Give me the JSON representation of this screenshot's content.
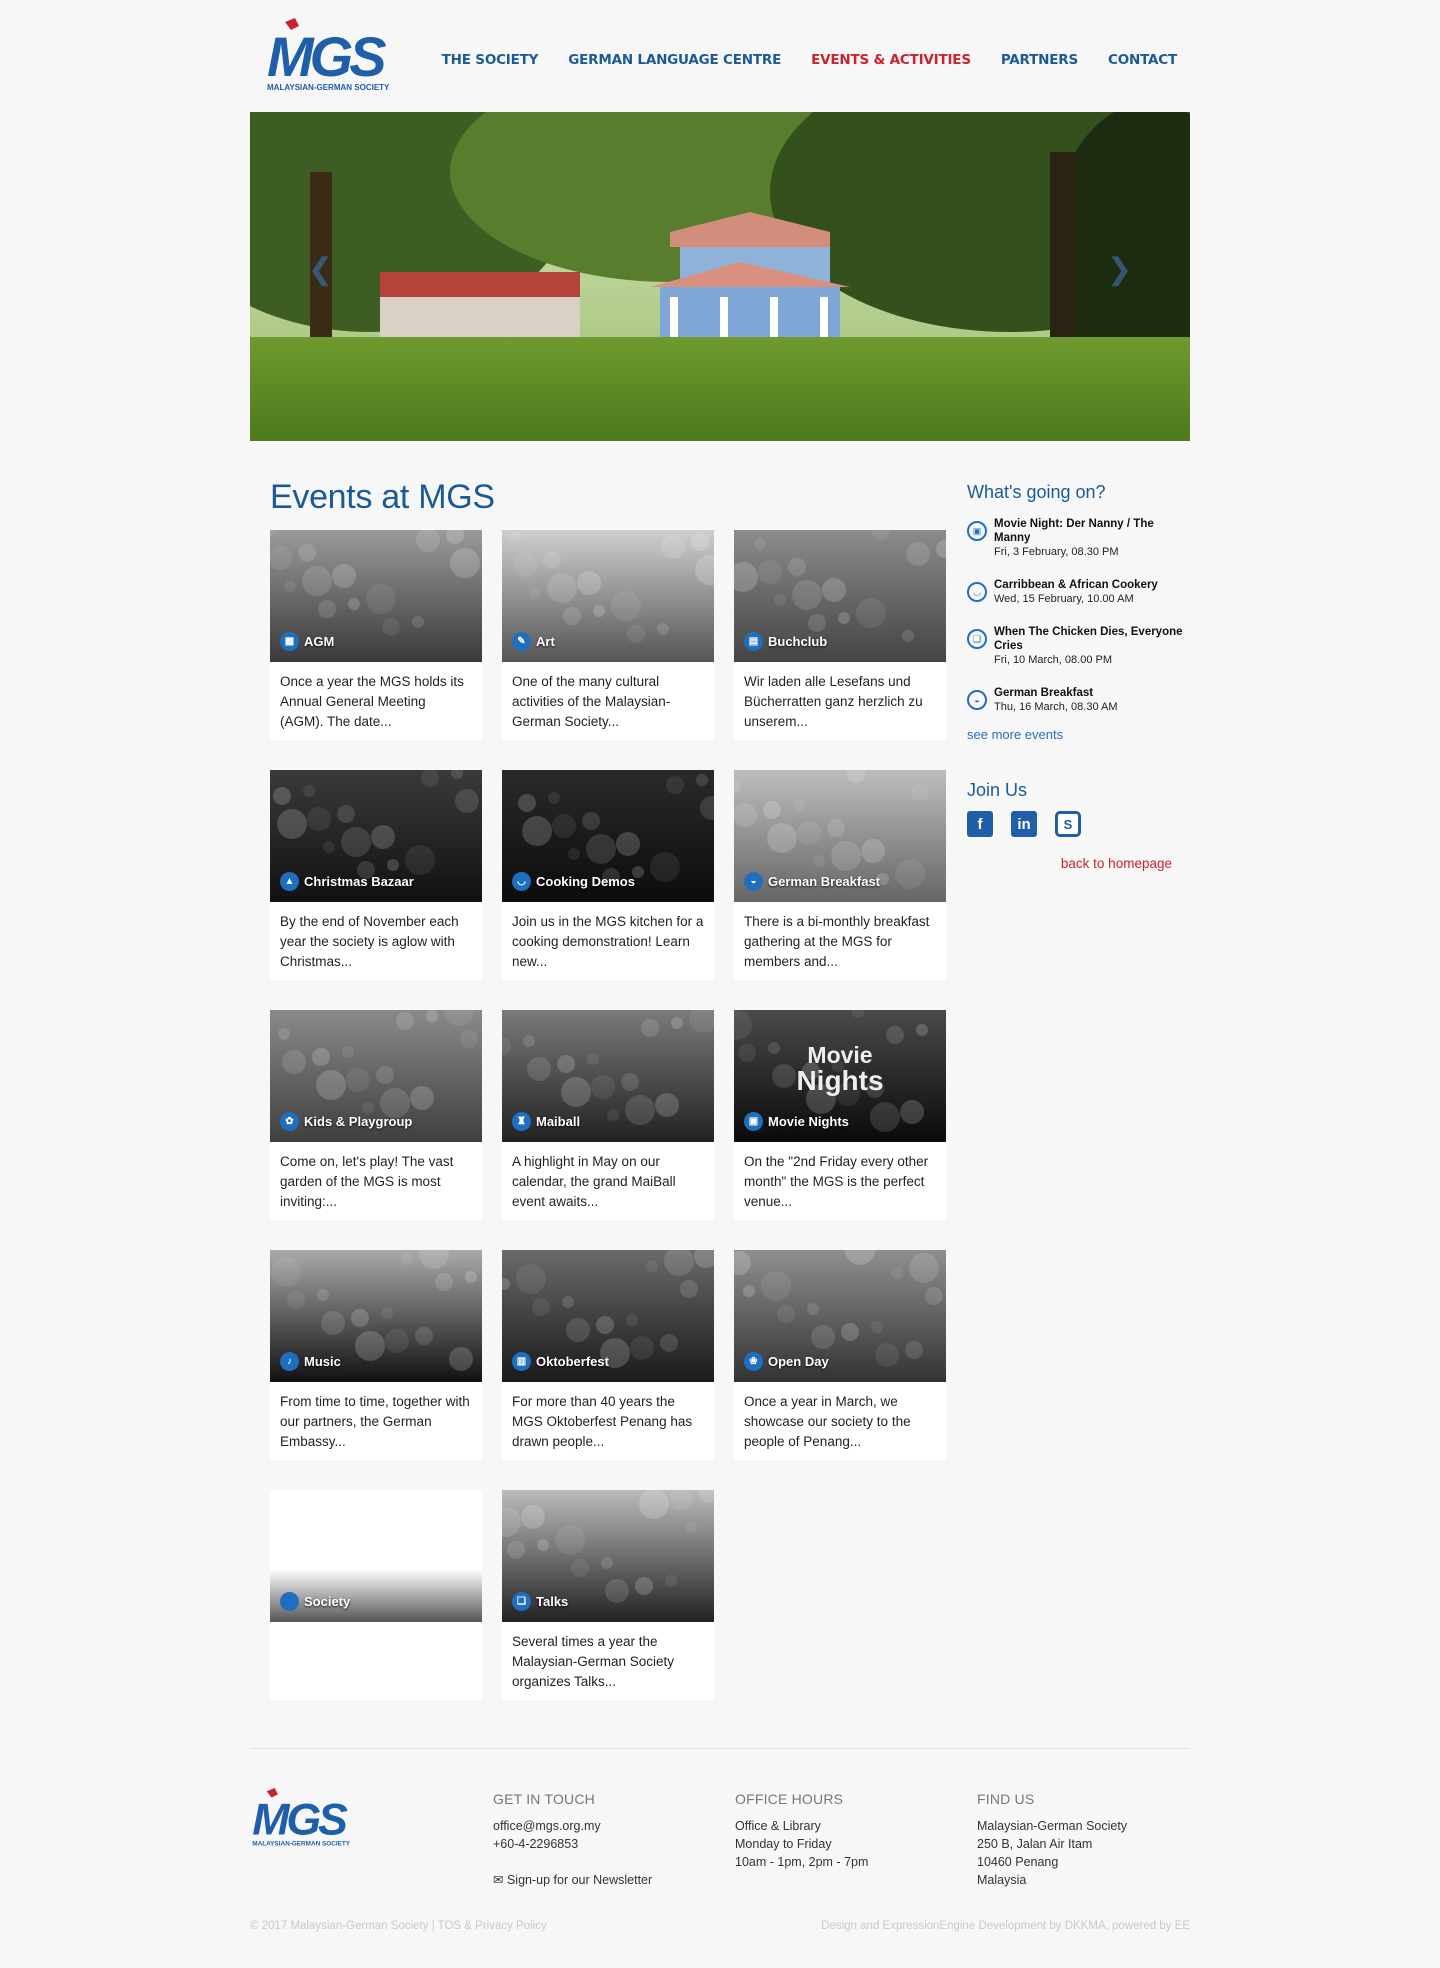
{
  "brand": {
    "logo_text": "MGS",
    "logo_sub": "MALAYSIAN-GERMAN SOCIETY",
    "blue": "#1c5a96",
    "red": "#c8232f"
  },
  "nav": [
    {
      "label": "THE SOCIETY",
      "active": false
    },
    {
      "label": "GERMAN LANGUAGE CENTRE",
      "active": false
    },
    {
      "label": "EVENTS & ACTIVITIES",
      "active": true
    },
    {
      "label": "PARTNERS",
      "active": false
    },
    {
      "label": "CONTACT",
      "active": false
    }
  ],
  "hero": {
    "prev_icon": "chevron-left-icon",
    "next_icon": "chevron-right-icon"
  },
  "page_title": "Events at MGS",
  "cards": [
    {
      "name": "AGM",
      "icon": "calendar-icon",
      "glyph": "▦",
      "desc": "Once a year the MGS holds its Annual General Meeting (AGM). The date..."
    },
    {
      "name": "Art",
      "icon": "palette-icon",
      "glyph": "✎",
      "desc": "One of the many cultural activities of the Malaysian-German Society..."
    },
    {
      "name": "Buchclub",
      "icon": "book-icon",
      "glyph": "▤",
      "desc": "Wir laden alle Lesefans und Bücherratten ganz herzlich zu unserem..."
    },
    {
      "name": "Christmas Bazaar",
      "icon": "tree-icon",
      "glyph": "▲",
      "desc": "By the end of November each year the society is aglow with Christmas..."
    },
    {
      "name": "Cooking Demos",
      "icon": "pot-icon",
      "glyph": "◡",
      "desc": "Join us in the MGS kitchen for a cooking demonstration! Learn new..."
    },
    {
      "name": "German Breakfast",
      "icon": "bread-icon",
      "glyph": "◒",
      "desc": "There is a bi-monthly breakfast gathering at the MGS for members and..."
    },
    {
      "name": "Kids & Playgroup",
      "icon": "ball-icon",
      "glyph": "✿",
      "desc": "Come on, let's play! The vast garden of the MGS is most inviting:..."
    },
    {
      "name": "Maiball",
      "icon": "glass-icon",
      "glyph": "♜",
      "desc": "A highlight in May on our calendar, the grand MaiBall event awaits..."
    },
    {
      "name": "Movie Nights",
      "icon": "film-icon",
      "glyph": "▣",
      "desc": "On the \"2nd Friday every other month\" the MGS is the perfect venue..."
    },
    {
      "name": "Music",
      "icon": "music-icon",
      "glyph": "♪",
      "desc": "From time to time, together with our partners, the German Embassy..."
    },
    {
      "name": "Oktoberfest",
      "icon": "beer-icon",
      "glyph": "▥",
      "desc": "For more than 40 years the MGS Oktoberfest Penang has drawn people..."
    },
    {
      "name": "Open Day",
      "icon": "flower-icon",
      "glyph": "❀",
      "desc": "Once a year in March, we showcase our society to the people of Penang..."
    },
    {
      "name": "Society",
      "icon": "circle-icon",
      "glyph": "",
      "desc": ""
    },
    {
      "name": "Talks",
      "icon": "speech-icon",
      "glyph": "❏",
      "desc": "Several times a year the Malaysian-German Society organizes Talks..."
    }
  ],
  "movie_poster": {
    "line1": "Movie",
    "line2": "Nights"
  },
  "sidebar": {
    "heading": "What's going on?",
    "events": [
      {
        "title": "Movie Night: Der Nanny / The Manny",
        "date": "Fri, 3 February, 08.30 PM",
        "glyph": "▣"
      },
      {
        "title": "Carribbean & African Cookery",
        "date": "Wed, 15 February, 10.00 AM",
        "glyph": "◡"
      },
      {
        "title": "When The Chicken Dies, Everyone Cries",
        "date": "Fri, 10 March, 08.00 PM",
        "glyph": "❏"
      },
      {
        "title": "German Breakfast",
        "date": "Thu, 16 March, 08.30 AM",
        "glyph": "◒"
      }
    ],
    "more": "see more events",
    "join": "Join Us",
    "social": [
      {
        "label": "f",
        "icon": "facebook-icon"
      },
      {
        "label": "in",
        "icon": "linkedin-icon"
      },
      {
        "label": "S",
        "icon": "skype-icon"
      }
    ],
    "back": "back to homepage"
  },
  "footer": {
    "touch": {
      "heading": "GET IN TOUCH",
      "email": "office@mgs.org.my",
      "phone": "+60-4-2296853",
      "newsletter": "Sign-up for our Newsletter"
    },
    "hours": {
      "heading": "OFFICE HOURS",
      "l1": "Office & Library",
      "l2": "Monday to Friday",
      "l3": "10am - 1pm, 2pm - 7pm"
    },
    "find": {
      "heading": "FIND US",
      "l1": "Malaysian-German Society",
      "l2": "250 B, Jalan Air Itam",
      "l3": "10460 Penang",
      "l4": "Malaysia"
    },
    "copyright": "© 2017 Malaysian-German Society | TOS & Privacy Policy",
    "credit": "Design and ExpressionEngine Development by DKKMA, powered by EE"
  }
}
